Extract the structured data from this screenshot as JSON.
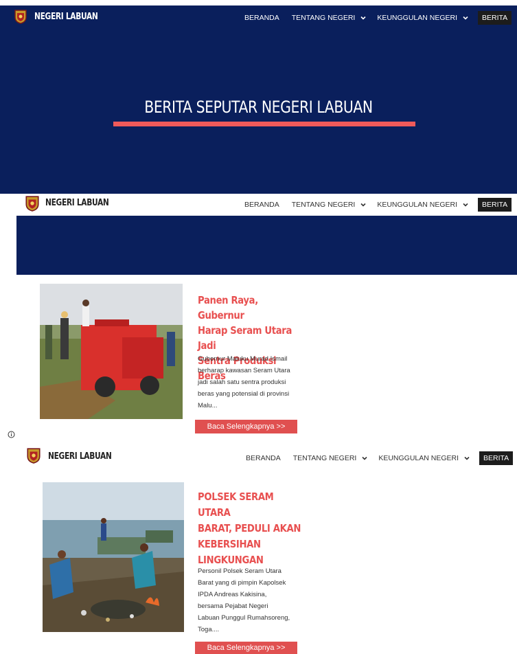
{
  "nav": {
    "brand": "NEGERI LABUAN",
    "items": [
      {
        "label": "BERANDA",
        "has_dropdown": false
      },
      {
        "label": "TENTANG NEGERI",
        "has_dropdown": true
      },
      {
        "label": "KEUNGGULAN NEGERI",
        "has_dropdown": true
      },
      {
        "label": "BERITA",
        "has_dropdown": false,
        "active": true
      }
    ],
    "search_icon": "search-icon"
  },
  "hero": {
    "title": "BERITA SEPUTAR NEGERI LABUAN"
  },
  "articles": [
    {
      "title": "Panen Raya, Gubernur Harap Seram Utara Jadi Sentra Produksi Beras",
      "title_lines": [
        "Panen Raya, Gubernur",
        "Harap Seram Utara Jadi",
        "Sentra Produksi Beras"
      ],
      "excerpt_lines": [
        "Gubernur Maluku Murad Ismail",
        "berharap kawasan Seram Utara",
        "jadi salah satu sentra produksi",
        "beras yang potensial di provinsi",
        "Malu..."
      ],
      "button": "Baca Selengkapnya >>"
    },
    {
      "title": "POLSEK SERAM UTARA BARAT, PEDULI AKAN KEBERSIHAN LINGKUNGAN",
      "title_lines": [
        "POLSEK SERAM UTARA",
        "BARAT, PEDULI AKAN",
        "KEBERSIHAN",
        "LINGKUNGAN"
      ],
      "excerpt_lines": [
        "Personil Polsek Seram Utara",
        "Barat yang di pimpin Kapolsek",
        "IPDA Andreas Kakisina,",
        "bersama Pejabat Negeri",
        "Labuan Punggul Rumahsoreng,",
        "Toga...."
      ],
      "button": "Baca Selengkapnya >>"
    }
  ],
  "colors": {
    "navy": "#0a1f5c",
    "accent": "#e85050",
    "button": "#e05050"
  }
}
